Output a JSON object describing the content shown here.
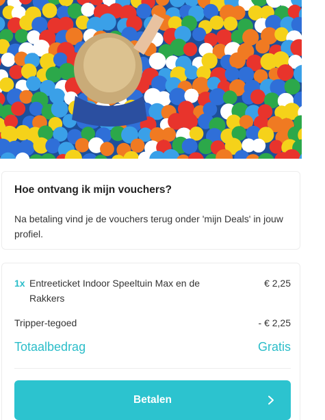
{
  "hero": {
    "icon": "ball-pit-photo",
    "ball_colors": [
      "#e8342c",
      "#2f6fd8",
      "#f5d21a",
      "#2ca84a",
      "#f07a22",
      "#ffffff",
      "#3aa0e8"
    ]
  },
  "info": {
    "title": "Hoe ontvang ik mijn vouchers?",
    "body": "Na betaling vind je de vouchers terug onder 'mijn Deals' in jouw profiel."
  },
  "order": {
    "items": [
      {
        "qty": "1x",
        "name": "Entreeticket Indoor Speeltuin Max en de Rakkers",
        "price": "€ 2,25"
      }
    ],
    "credit_label": "Tripper-tegoed",
    "credit_amount": "- € 2,25",
    "total_label": "Totaalbedrag",
    "total_amount": "Gratis"
  },
  "pay": {
    "label": "Betalen",
    "icon": "chevron-right-icon"
  },
  "colors": {
    "accent": "#2bbdc9",
    "button": "#2cc3cf"
  }
}
